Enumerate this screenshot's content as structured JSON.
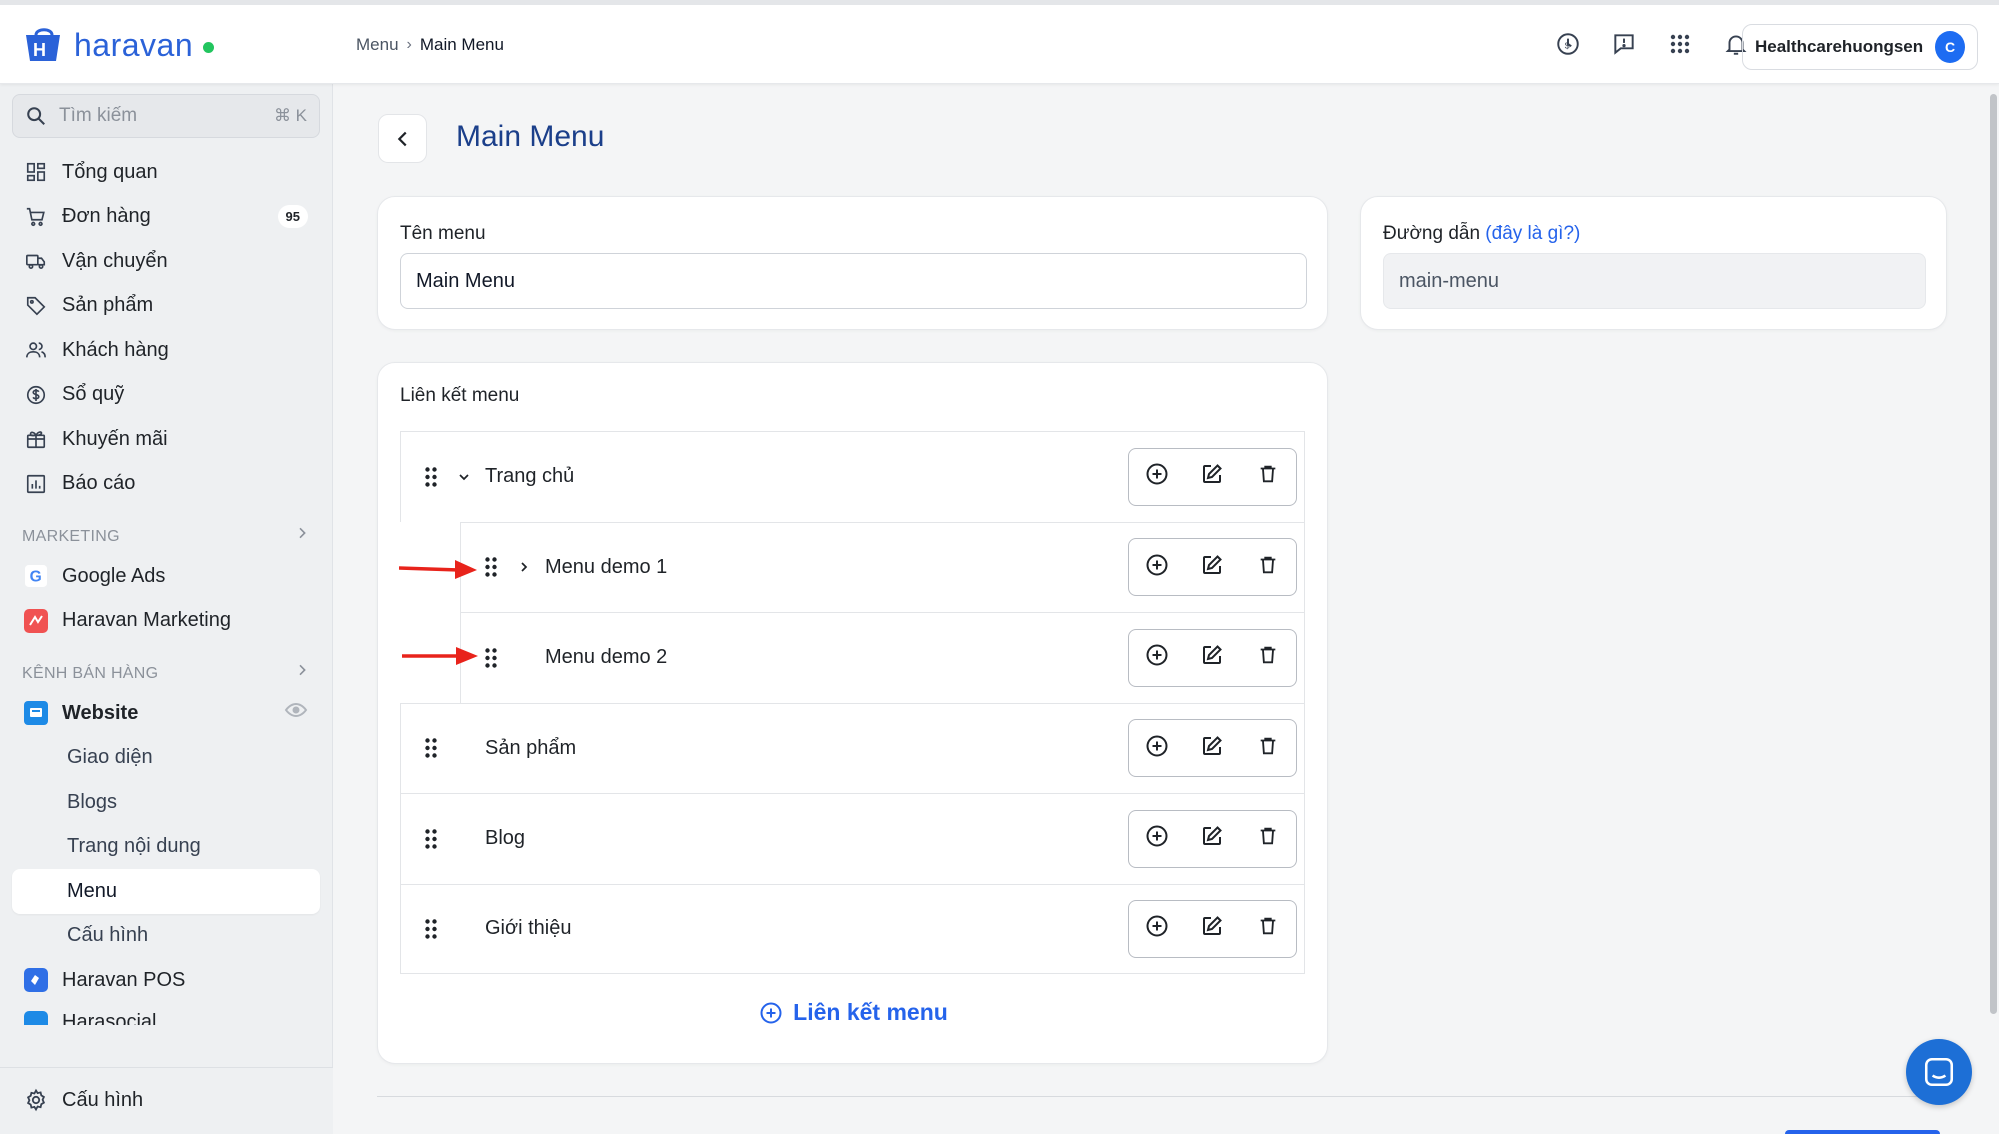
{
  "app": {
    "logo_text": "haravan"
  },
  "breadcrumb": {
    "parent": "Menu",
    "current": "Main Menu"
  },
  "topbar": {
    "icons": [
      "history-icon",
      "feedback-icon",
      "apps-grid-icon",
      "bell-icon"
    ],
    "account_name": "Healthcarehuongsen",
    "avatar_initial": "C"
  },
  "sidebar": {
    "search_placeholder": "Tìm kiếm",
    "search_shortcut": "⌘ K",
    "main_items": [
      {
        "label": "Tổng quan",
        "icon": "dashboard-icon"
      },
      {
        "label": "Đơn hàng",
        "icon": "cart-icon",
        "badge": "95"
      },
      {
        "label": "Vận chuyển",
        "icon": "truck-icon"
      },
      {
        "label": "Sản phẩm",
        "icon": "tag-icon"
      },
      {
        "label": "Khách hàng",
        "icon": "users-icon"
      },
      {
        "label": "Sổ quỹ",
        "icon": "dollar-icon"
      },
      {
        "label": "Khuyến mãi",
        "icon": "gift-icon"
      },
      {
        "label": "Báo cáo",
        "icon": "report-icon"
      }
    ],
    "marketing_heading": "MARKETING",
    "marketing_items": [
      {
        "label": "Google Ads",
        "icon": "google-icon"
      },
      {
        "label": "Haravan Marketing",
        "icon": "haravan-marketing-icon"
      }
    ],
    "sales_heading": "KÊNH BÁN HÀNG",
    "website_label": "Website",
    "website_subitems": [
      "Giao diện",
      "Blogs",
      "Trang nội dung",
      "Menu",
      "Cấu hình"
    ],
    "active_subitem": "Menu",
    "pos_label": "Haravan POS",
    "harasocial_label": "Harasocial",
    "settings_label": "Cấu hình"
  },
  "page": {
    "title": "Main Menu",
    "name_label": "Tên menu",
    "name_value": "Main Menu",
    "url_label": "Đường dẫn",
    "url_help": "(đây là gì?)",
    "url_value": "main-menu",
    "links_title": "Liên kết menu",
    "add_link_label": "Liên kết menu"
  },
  "menu_links": [
    {
      "label": "Trang chủ",
      "level": 0,
      "expander": "expanded"
    },
    {
      "label": "Menu demo 1",
      "level": 1,
      "expander": "collapsed"
    },
    {
      "label": "Menu demo 2",
      "level": 1,
      "expander": "none"
    },
    {
      "label": "Sản phẩm",
      "level": 0,
      "expander": "none"
    },
    {
      "label": "Blog",
      "level": 0,
      "expander": "none"
    },
    {
      "label": "Giới thiệu",
      "level": 0,
      "expander": "none"
    }
  ],
  "colors": {
    "brand": "#2b62d8",
    "accent": "#2563eb",
    "title": "#1b3f8a",
    "annotation_arrow": "#e8231b"
  }
}
